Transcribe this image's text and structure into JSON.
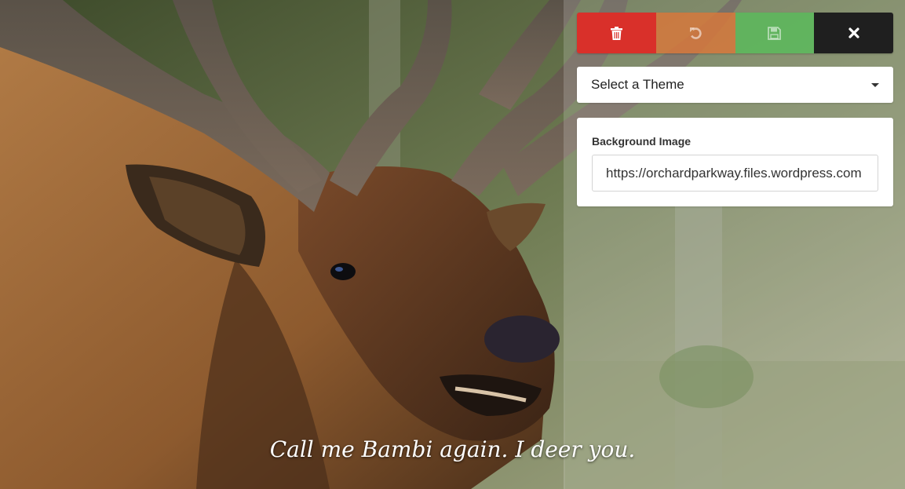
{
  "toolbar": {
    "buttons": [
      {
        "name": "delete",
        "icon": "trash-icon",
        "color": "#d9302a"
      },
      {
        "name": "undo",
        "icon": "undo-icon",
        "color": "#d6783c"
      },
      {
        "name": "save",
        "icon": "floppy-disk-icon",
        "color": "#5cb85c"
      },
      {
        "name": "close",
        "icon": "close-icon",
        "color": "#1f1f1f"
      }
    ]
  },
  "theme_select": {
    "selected": "Select a Theme"
  },
  "background_image": {
    "label": "Background Image",
    "value": "https://orchardparkway.files.wordpress.com"
  },
  "quote": {
    "text": "Call me Bambi again.  I deer you."
  }
}
